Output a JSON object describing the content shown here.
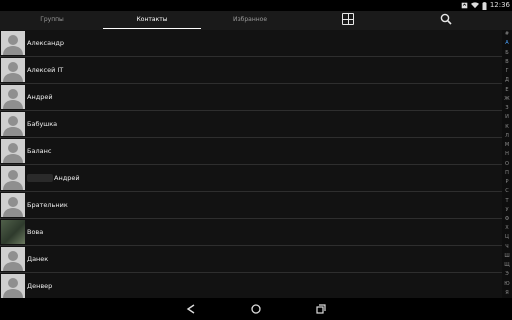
{
  "status": {
    "icons": [
      "notification-icon",
      "wifi-icon",
      "battery-icon"
    ],
    "time": "12:36"
  },
  "tabs": [
    {
      "label": "Группы",
      "active": false
    },
    {
      "label": "Контакты",
      "active": true
    },
    {
      "label": "Избранное",
      "active": false
    }
  ],
  "contacts": [
    {
      "name": "Александр",
      "avatar": "default"
    },
    {
      "name": "Алексей IT",
      "avatar": "default"
    },
    {
      "name": "Андрей",
      "avatar": "default"
    },
    {
      "name": "Бабушка",
      "avatar": "default"
    },
    {
      "name": "Баланс",
      "avatar": "default"
    },
    {
      "name": "Андрей",
      "avatar": "default",
      "blurred_prefix": true
    },
    {
      "name": "Брательник",
      "avatar": "default"
    },
    {
      "name": "Вова",
      "avatar": "photo"
    },
    {
      "name": "Данек",
      "avatar": "default"
    },
    {
      "name": "Денвер",
      "avatar": "default"
    }
  ],
  "index_letters": [
    "#",
    "А",
    "Б",
    "В",
    "Г",
    "Д",
    "Е",
    "Ж",
    "З",
    "И",
    "К",
    "Л",
    "М",
    "Н",
    "О",
    "П",
    "Р",
    "С",
    "Т",
    "У",
    "Ф",
    "Х",
    "Ц",
    "Ч",
    "Ш",
    "Щ",
    "Э",
    "Ю",
    "Я"
  ],
  "index_active": "А",
  "colors": {
    "background": "#121212",
    "actionbar": "#1a1a1a",
    "index_active": "#4aa3ff",
    "divider": "#2e2e2e"
  }
}
